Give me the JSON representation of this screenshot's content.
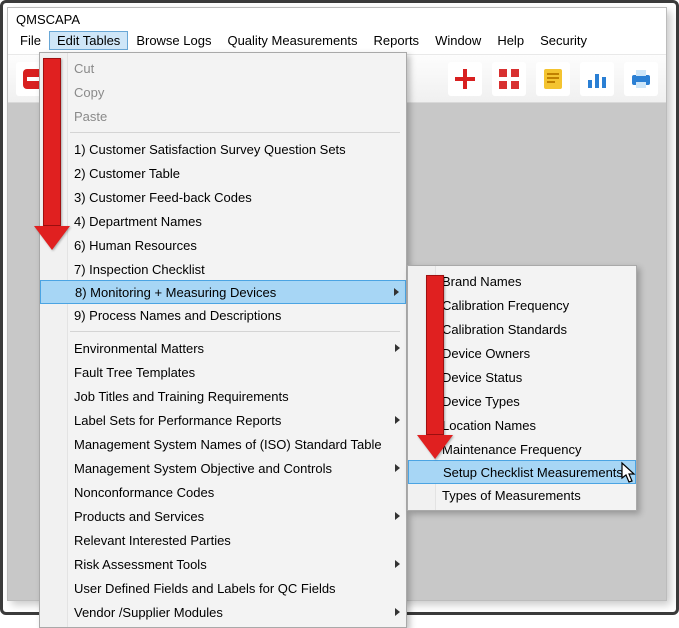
{
  "window": {
    "title": "QMSCAPA"
  },
  "menubar": {
    "items": [
      "File",
      "Edit Tables",
      "Browse Logs",
      "Quality Measurements",
      "Reports",
      "Window",
      "Help",
      "Security"
    ],
    "active_index": 1
  },
  "dropdown_main": {
    "top_disabled": [
      "Cut",
      "Copy",
      "Paste"
    ],
    "numbered": [
      "1) Customer Satisfaction Survey Question Sets",
      "2) Customer Table",
      "3) Customer Feed-back Codes",
      "4) Department Names",
      "6) Human Resources",
      "7) Inspection Checklist",
      "8) Monitoring + Measuring Devices",
      "9) Process Names and Descriptions"
    ],
    "numbered_selected_index": 6,
    "numbered_submenu_at": 6,
    "lower": [
      {
        "label": "Environmental Matters",
        "sub": true
      },
      {
        "label": "Fault Tree Templates",
        "sub": false
      },
      {
        "label": "Job Titles and Training Requirements",
        "sub": false
      },
      {
        "label": "Label Sets for Performance Reports",
        "sub": true
      },
      {
        "label": "Management System Names of (ISO) Standard Table",
        "sub": false
      },
      {
        "label": "Management System Objective and Controls",
        "sub": true
      },
      {
        "label": "Nonconformance Codes",
        "sub": false
      },
      {
        "label": "Products and Services",
        "sub": true
      },
      {
        "label": "Relevant Interested Parties",
        "sub": false
      },
      {
        "label": "Risk Assessment Tools",
        "sub": true
      },
      {
        "label": "User Defined Fields and Labels for QC Fields",
        "sub": false
      },
      {
        "label": "Vendor /Supplier Modules",
        "sub": true
      }
    ]
  },
  "dropdown_sub": {
    "items": [
      "Brand Names",
      "Calibration Frequency",
      "Calibration Standards",
      "Device Owners",
      "Device Status",
      "Device Types",
      "Location Names",
      "Maintenance Frequency",
      "Setup Checklist Measurements",
      "Types of Measurements"
    ],
    "selected_index": 8
  },
  "toolbar": {
    "icons": [
      "stop",
      "plus",
      "grid",
      "notes",
      "bars",
      "printer"
    ]
  }
}
